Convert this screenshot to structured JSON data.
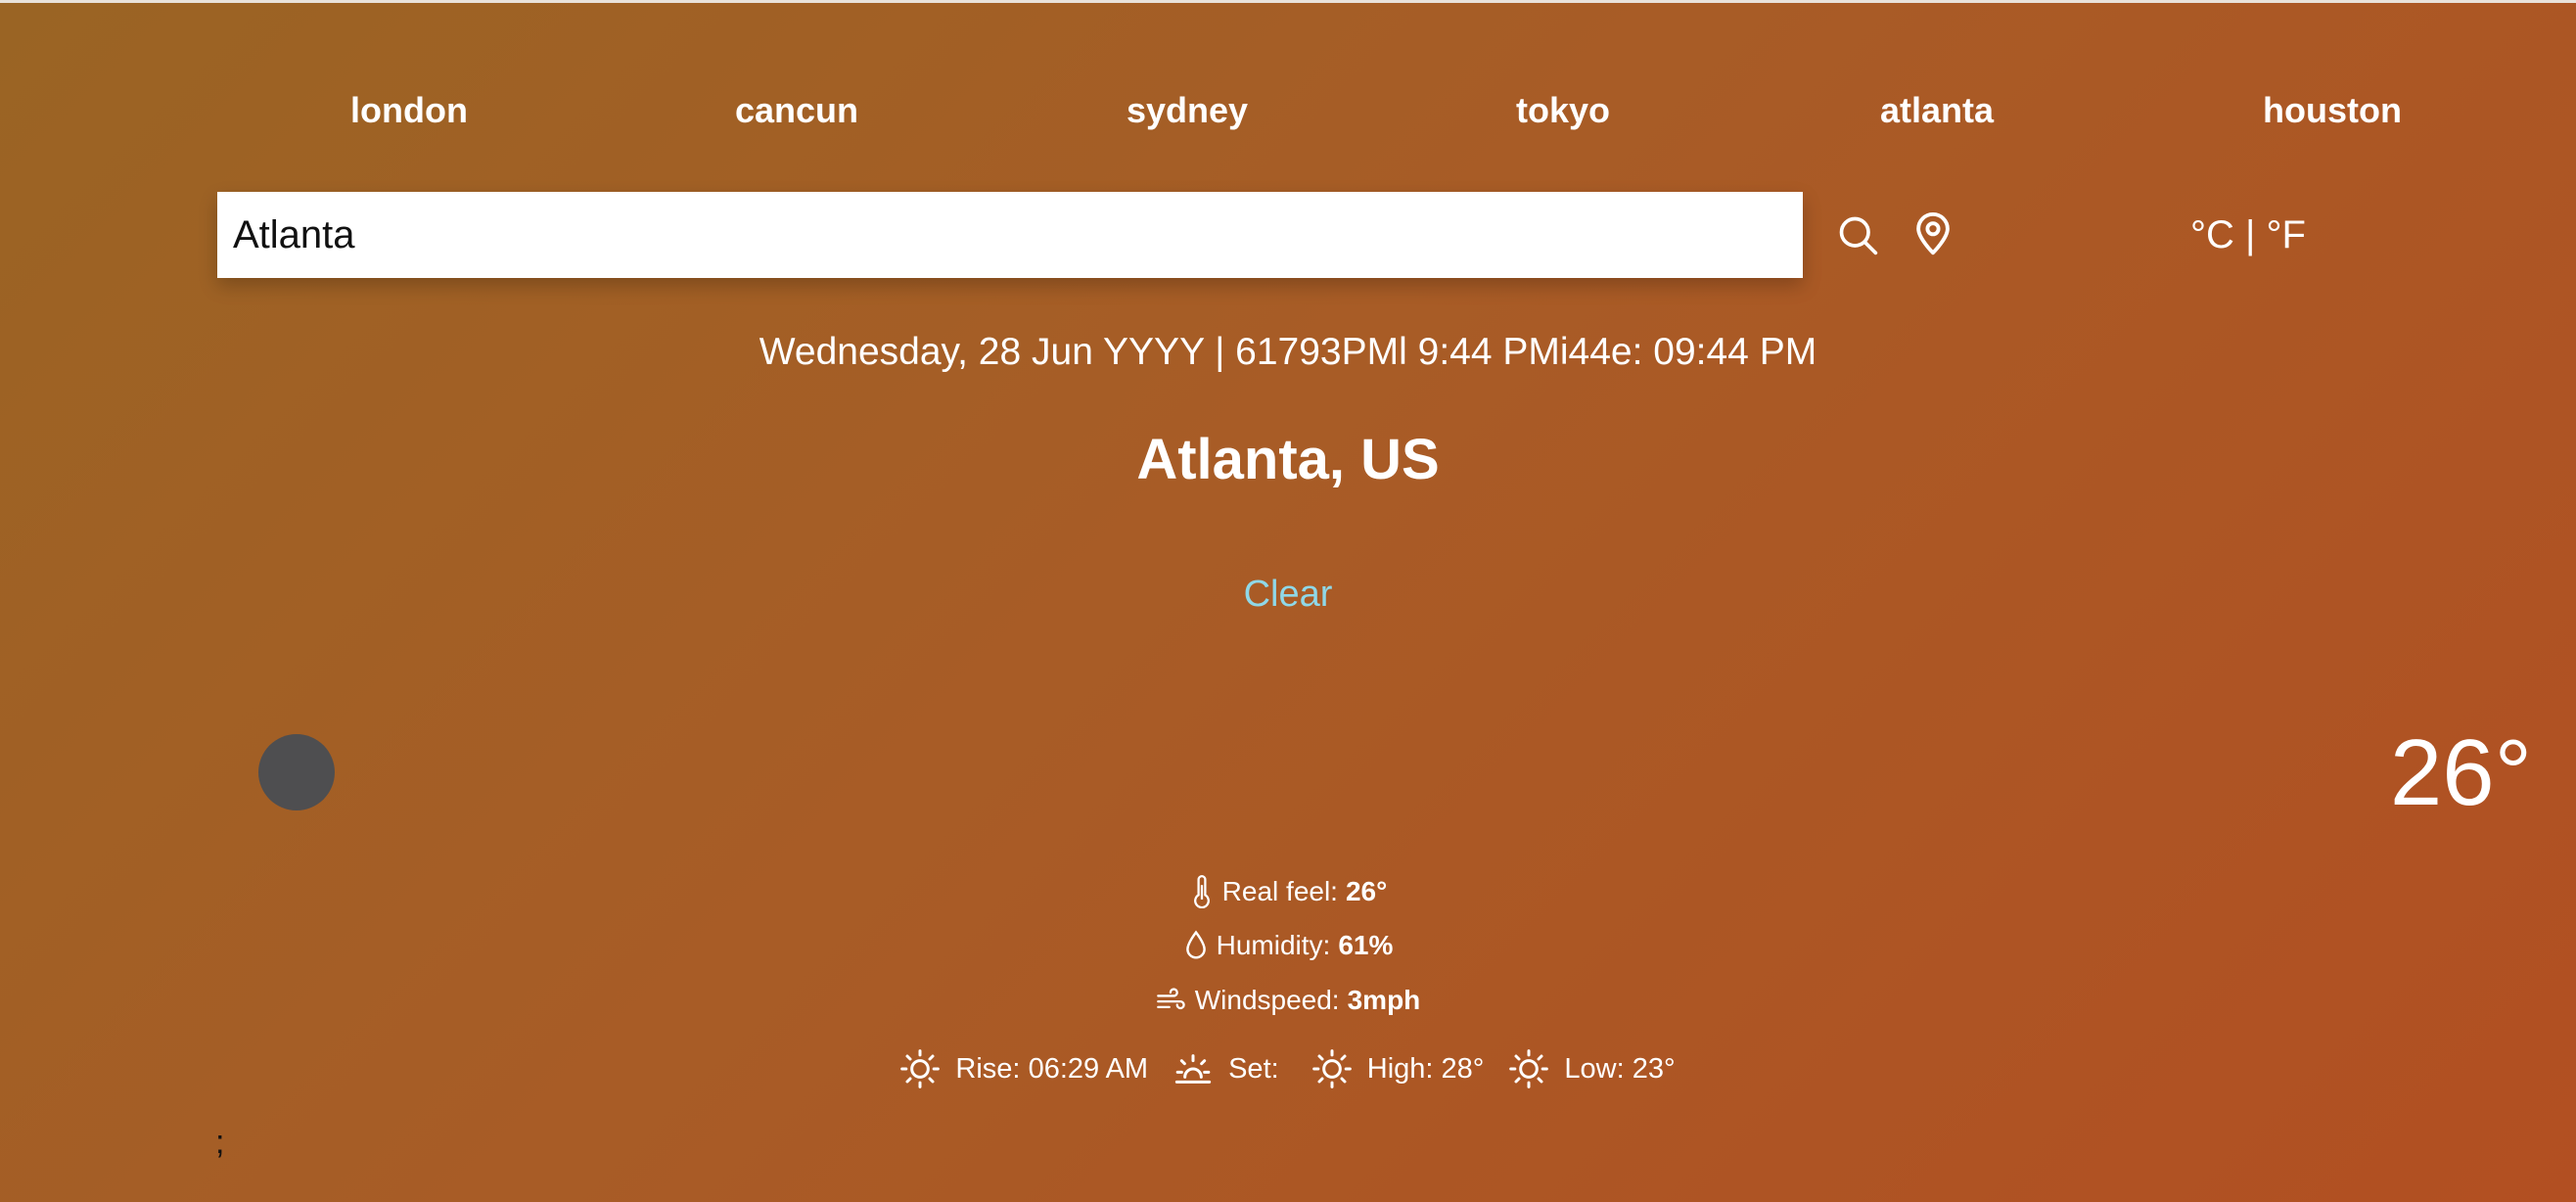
{
  "cities": [
    "london",
    "cancun",
    "sydney",
    "tokyo",
    "atlanta",
    "houston"
  ],
  "search": {
    "value": "Atlanta",
    "placeholder": ""
  },
  "units": {
    "celsius": "°C",
    "separator": "|",
    "fahrenheit": "°F"
  },
  "datetime": "Wednesday, 28 Jun YYYY | 61793PMl 9:44 PMi44e: 09:44 PM",
  "location": "Atlanta, US",
  "condition": "Clear",
  "temperature": "26°",
  "details": {
    "realfeel_label": "Real feel:",
    "realfeel_value": "26°",
    "humidity_label": "Humidity:",
    "humidity_value": "61%",
    "wind_label": "Windspeed:",
    "wind_value": "3mph"
  },
  "sun": {
    "rise_label": "Rise:",
    "rise_value": "06:29 AM",
    "set_label": "Set:",
    "set_value": "",
    "high_label": "High:",
    "high_value": "28°",
    "low_label": "Low:",
    "low_value": "23°"
  },
  "footer_text": ";",
  "colors": {
    "condition": "#8fd8e8",
    "icon_placeholder": "#4e4e50"
  },
  "icons": [
    "search-icon",
    "location-pin-icon",
    "thermometer-icon",
    "droplet-icon",
    "wind-icon",
    "sun-icon",
    "sunset-icon"
  ]
}
